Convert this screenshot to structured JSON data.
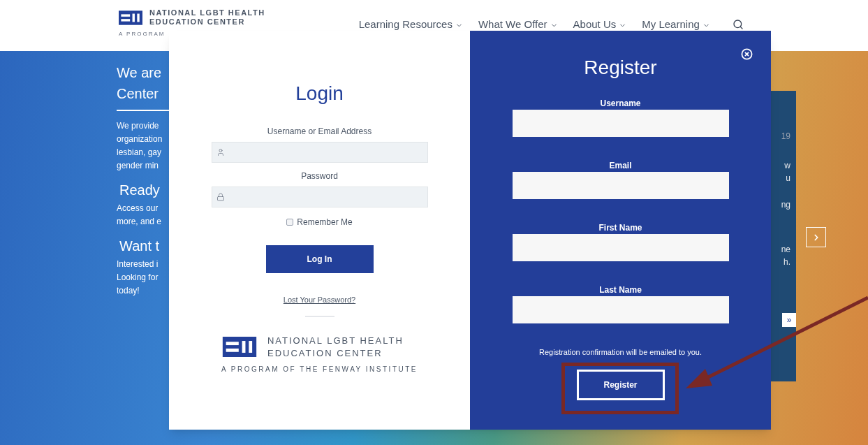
{
  "header": {
    "logo": {
      "line1": "NATIONAL LGBT HEALTH",
      "line2": "EDUCATION CENTER",
      "tagline": "A PROGRAM"
    },
    "nav": [
      {
        "label": "Learning Resources",
        "kind": "dropdown"
      },
      {
        "label": "What We Offer",
        "kind": "dropdown"
      },
      {
        "label": "About Us",
        "kind": "dropdown"
      },
      {
        "label": "My Learning",
        "kind": "dropdown"
      }
    ]
  },
  "hero": {
    "left": [
      {
        "kind": "heading",
        "text": "We are"
      },
      {
        "kind": "heading",
        "text": "Center"
      },
      {
        "kind": "rule"
      },
      {
        "kind": "body",
        "text": "We provide"
      },
      {
        "kind": "body",
        "text": "organization"
      },
      {
        "kind": "body",
        "text": "lesbian, gay"
      },
      {
        "kind": "body",
        "text": "gender min"
      },
      {
        "kind": "subheading",
        "text": "Ready"
      },
      {
        "kind": "body",
        "text": "Access our"
      },
      {
        "kind": "body",
        "text": "more, and e"
      },
      {
        "kind": "subheading",
        "text": "Want t"
      },
      {
        "kind": "body",
        "text": "Interested i"
      },
      {
        "kind": "body",
        "text": "Looking for"
      },
      {
        "kind": "body",
        "text": "today!"
      }
    ],
    "card": [
      "19",
      "w",
      "u",
      "ng",
      "ne",
      "h."
    ],
    "card_link": "»"
  },
  "login": {
    "title": "Login",
    "fields": [
      {
        "label": "Username or Email Address",
        "kind": "user"
      },
      {
        "label": "Password",
        "kind": "lock"
      }
    ],
    "remember": {
      "label": "Remember Me",
      "checked": false
    },
    "button": "Log In",
    "lost_password": "Lost Your Password?",
    "logo": {
      "line1": "NATIONAL LGBT HEALTH",
      "line2": "EDUCATION CENTER",
      "tagline": "A PROGRAM OF THE FENWAY INSTITUTE"
    }
  },
  "register": {
    "title": "Register",
    "fields": [
      {
        "label": "Username"
      },
      {
        "label": "Email"
      },
      {
        "label": "First Name"
      },
      {
        "label": "Last Name"
      }
    ],
    "note": "Registration confirmation will be emailed to you.",
    "button": "Register"
  }
}
